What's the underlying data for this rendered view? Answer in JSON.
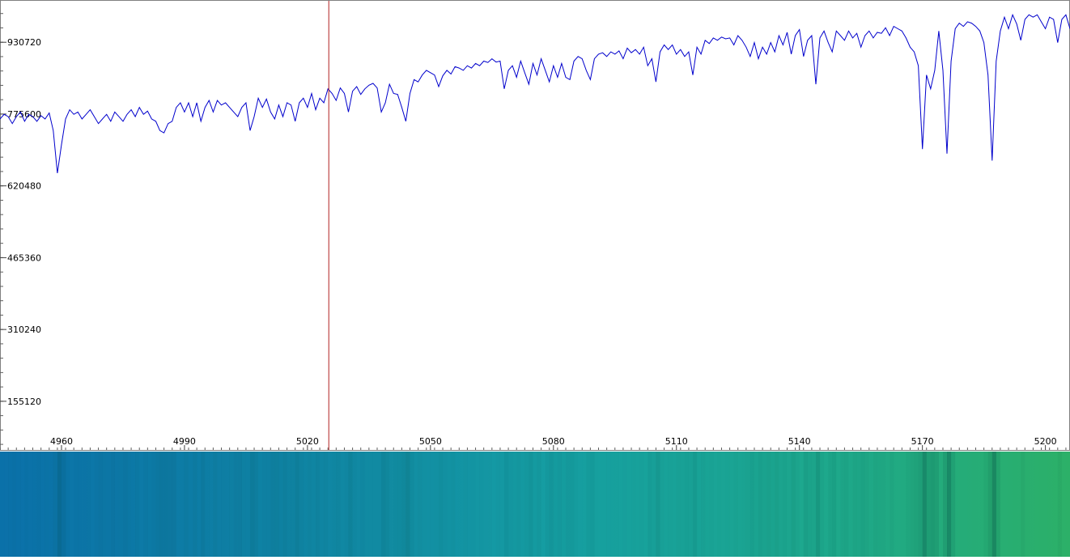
{
  "chart_data": {
    "type": "line",
    "title": "",
    "xlabel": "",
    "ylabel": "",
    "xlim": [
      4945,
      5206
    ],
    "ylim": [
      50000,
      1022000
    ],
    "xticks": [
      4960,
      4990,
      5020,
      5050,
      5080,
      5110,
      5140,
      5170,
      5200
    ],
    "yticks": [
      155120,
      310240,
      465360,
      620480,
      775600,
      930720
    ],
    "cursor_x": 5025.2,
    "line_color": "#0000cc",
    "cursor_color": "#b02020",
    "series": [
      {
        "values": [
          [
            4945,
            765000
          ],
          [
            4946,
            775000
          ],
          [
            4947,
            770000
          ],
          [
            4948,
            755000
          ],
          [
            4949,
            770000
          ],
          [
            4950,
            780000
          ],
          [
            4951,
            760000
          ],
          [
            4952,
            775000
          ],
          [
            4953,
            770000
          ],
          [
            4954,
            760000
          ],
          [
            4955,
            772000
          ],
          [
            4956,
            765000
          ],
          [
            4957,
            778000
          ],
          [
            4958,
            740000
          ],
          [
            4959,
            648000
          ],
          [
            4960,
            710000
          ],
          [
            4961,
            765000
          ],
          [
            4962,
            785000
          ],
          [
            4963,
            775000
          ],
          [
            4964,
            780000
          ],
          [
            4965,
            765000
          ],
          [
            4966,
            775000
          ],
          [
            4967,
            785000
          ],
          [
            4968,
            770000
          ],
          [
            4969,
            755000
          ],
          [
            4970,
            765000
          ],
          [
            4971,
            775000
          ],
          [
            4972,
            760000
          ],
          [
            4973,
            780000
          ],
          [
            4974,
            770000
          ],
          [
            4975,
            760000
          ],
          [
            4976,
            775000
          ],
          [
            4977,
            785000
          ],
          [
            4978,
            770000
          ],
          [
            4979,
            790000
          ],
          [
            4980,
            775000
          ],
          [
            4981,
            782000
          ],
          [
            4982,
            765000
          ],
          [
            4983,
            760000
          ],
          [
            4984,
            740000
          ],
          [
            4985,
            735000
          ],
          [
            4986,
            755000
          ],
          [
            4987,
            760000
          ],
          [
            4988,
            790000
          ],
          [
            4989,
            800000
          ],
          [
            4990,
            780000
          ],
          [
            4991,
            800000
          ],
          [
            4992,
            770000
          ],
          [
            4993,
            800000
          ],
          [
            4994,
            760000
          ],
          [
            4995,
            790000
          ],
          [
            4996,
            805000
          ],
          [
            4997,
            780000
          ],
          [
            4998,
            805000
          ],
          [
            4999,
            795000
          ],
          [
            5000,
            800000
          ],
          [
            5001,
            790000
          ],
          [
            5002,
            780000
          ],
          [
            5003,
            770000
          ],
          [
            5004,
            790000
          ],
          [
            5005,
            800000
          ],
          [
            5006,
            740000
          ],
          [
            5007,
            770000
          ],
          [
            5008,
            810000
          ],
          [
            5009,
            790000
          ],
          [
            5010,
            808000
          ],
          [
            5011,
            780000
          ],
          [
            5012,
            765000
          ],
          [
            5013,
            795000
          ],
          [
            5014,
            770000
          ],
          [
            5015,
            800000
          ],
          [
            5016,
            795000
          ],
          [
            5017,
            760000
          ],
          [
            5018,
            800000
          ],
          [
            5019,
            810000
          ],
          [
            5020,
            790000
          ],
          [
            5021,
            820000
          ],
          [
            5022,
            785000
          ],
          [
            5023,
            810000
          ],
          [
            5024,
            800000
          ],
          [
            5025,
            830000
          ],
          [
            5026,
            820000
          ],
          [
            5027,
            805000
          ],
          [
            5028,
            832000
          ],
          [
            5029,
            820000
          ],
          [
            5030,
            780000
          ],
          [
            5031,
            825000
          ],
          [
            5032,
            835000
          ],
          [
            5033,
            818000
          ],
          [
            5034,
            830000
          ],
          [
            5035,
            838000
          ],
          [
            5036,
            842000
          ],
          [
            5037,
            832000
          ],
          [
            5038,
            780000
          ],
          [
            5039,
            800000
          ],
          [
            5040,
            840000
          ],
          [
            5041,
            820000
          ],
          [
            5042,
            818000
          ],
          [
            5043,
            790000
          ],
          [
            5044,
            760000
          ],
          [
            5045,
            820000
          ],
          [
            5046,
            850000
          ],
          [
            5047,
            845000
          ],
          [
            5048,
            860000
          ],
          [
            5049,
            870000
          ],
          [
            5050,
            865000
          ],
          [
            5051,
            860000
          ],
          [
            5052,
            835000
          ],
          [
            5053,
            858000
          ],
          [
            5054,
            870000
          ],
          [
            5055,
            862000
          ],
          [
            5056,
            878000
          ],
          [
            5057,
            875000
          ],
          [
            5058,
            870000
          ],
          [
            5059,
            880000
          ],
          [
            5060,
            875000
          ],
          [
            5061,
            885000
          ],
          [
            5062,
            880000
          ],
          [
            5063,
            890000
          ],
          [
            5064,
            887000
          ],
          [
            5065,
            895000
          ],
          [
            5066,
            888000
          ],
          [
            5067,
            890000
          ],
          [
            5068,
            830000
          ],
          [
            5069,
            870000
          ],
          [
            5070,
            880000
          ],
          [
            5071,
            855000
          ],
          [
            5072,
            890000
          ],
          [
            5073,
            865000
          ],
          [
            5074,
            840000
          ],
          [
            5075,
            885000
          ],
          [
            5076,
            860000
          ],
          [
            5077,
            895000
          ],
          [
            5078,
            870000
          ],
          [
            5079,
            845000
          ],
          [
            5080,
            880000
          ],
          [
            5081,
            855000
          ],
          [
            5082,
            885000
          ],
          [
            5083,
            855000
          ],
          [
            5084,
            850000
          ],
          [
            5085,
            890000
          ],
          [
            5086,
            900000
          ],
          [
            5087,
            895000
          ],
          [
            5088,
            870000
          ],
          [
            5089,
            850000
          ],
          [
            5090,
            895000
          ],
          [
            5091,
            905000
          ],
          [
            5092,
            908000
          ],
          [
            5093,
            900000
          ],
          [
            5094,
            910000
          ],
          [
            5095,
            905000
          ],
          [
            5096,
            912000
          ],
          [
            5097,
            895000
          ],
          [
            5098,
            918000
          ],
          [
            5099,
            908000
          ],
          [
            5100,
            915000
          ],
          [
            5101,
            905000
          ],
          [
            5102,
            920000
          ],
          [
            5103,
            880000
          ],
          [
            5104,
            895000
          ],
          [
            5105,
            845000
          ],
          [
            5106,
            910000
          ],
          [
            5107,
            925000
          ],
          [
            5108,
            915000
          ],
          [
            5109,
            925000
          ],
          [
            5110,
            905000
          ],
          [
            5111,
            915000
          ],
          [
            5112,
            900000
          ],
          [
            5113,
            910000
          ],
          [
            5114,
            860000
          ],
          [
            5115,
            920000
          ],
          [
            5116,
            905000
          ],
          [
            5117,
            935000
          ],
          [
            5118,
            928000
          ],
          [
            5119,
            940000
          ],
          [
            5120,
            935000
          ],
          [
            5121,
            942000
          ],
          [
            5122,
            938000
          ],
          [
            5123,
            940000
          ],
          [
            5124,
            925000
          ],
          [
            5125,
            945000
          ],
          [
            5126,
            935000
          ],
          [
            5127,
            920000
          ],
          [
            5128,
            900000
          ],
          [
            5129,
            930000
          ],
          [
            5130,
            895000
          ],
          [
            5131,
            920000
          ],
          [
            5132,
            905000
          ],
          [
            5133,
            930000
          ],
          [
            5134,
            910000
          ],
          [
            5135,
            945000
          ],
          [
            5136,
            925000
          ],
          [
            5137,
            952000
          ],
          [
            5138,
            905000
          ],
          [
            5139,
            945000
          ],
          [
            5140,
            958000
          ],
          [
            5141,
            900000
          ],
          [
            5142,
            935000
          ],
          [
            5143,
            945000
          ],
          [
            5144,
            840000
          ],
          [
            5145,
            940000
          ],
          [
            5146,
            955000
          ],
          [
            5147,
            930000
          ],
          [
            5148,
            910000
          ],
          [
            5149,
            955000
          ],
          [
            5150,
            945000
          ],
          [
            5151,
            935000
          ],
          [
            5152,
            955000
          ],
          [
            5153,
            940000
          ],
          [
            5154,
            950000
          ],
          [
            5155,
            920000
          ],
          [
            5156,
            945000
          ],
          [
            5157,
            955000
          ],
          [
            5158,
            940000
          ],
          [
            5159,
            952000
          ],
          [
            5160,
            950000
          ],
          [
            5161,
            962000
          ],
          [
            5162,
            945000
          ],
          [
            5163,
            965000
          ],
          [
            5164,
            960000
          ],
          [
            5165,
            955000
          ],
          [
            5166,
            940000
          ],
          [
            5167,
            920000
          ],
          [
            5168,
            910000
          ],
          [
            5169,
            880000
          ],
          [
            5170,
            700000
          ],
          [
            5171,
            860000
          ],
          [
            5172,
            830000
          ],
          [
            5173,
            870000
          ],
          [
            5174,
            955000
          ],
          [
            5175,
            870000
          ],
          [
            5176,
            690000
          ],
          [
            5177,
            890000
          ],
          [
            5178,
            960000
          ],
          [
            5179,
            972000
          ],
          [
            5180,
            965000
          ],
          [
            5181,
            975000
          ],
          [
            5182,
            972000
          ],
          [
            5183,
            965000
          ],
          [
            5184,
            955000
          ],
          [
            5185,
            930000
          ],
          [
            5186,
            860000
          ],
          [
            5187,
            675000
          ],
          [
            5188,
            890000
          ],
          [
            5189,
            955000
          ],
          [
            5190,
            985000
          ],
          [
            5191,
            960000
          ],
          [
            5192,
            990000
          ],
          [
            5193,
            970000
          ],
          [
            5194,
            935000
          ],
          [
            5195,
            980000
          ],
          [
            5196,
            990000
          ],
          [
            5197,
            985000
          ],
          [
            5198,
            990000
          ],
          [
            5199,
            975000
          ],
          [
            5200,
            960000
          ],
          [
            5201,
            985000
          ],
          [
            5202,
            980000
          ],
          [
            5203,
            930000
          ],
          [
            5204,
            980000
          ],
          [
            5205,
            990000
          ],
          [
            5206,
            960000
          ]
        ]
      }
    ]
  },
  "spectrum_strip": {
    "gradient_stops": [
      {
        "pos": 0.0,
        "color": "#0e80c8"
      },
      {
        "pos": 0.35,
        "color": "#1498b4"
      },
      {
        "pos": 0.55,
        "color": "#18a8a8"
      },
      {
        "pos": 0.8,
        "color": "#1ea888"
      },
      {
        "pos": 1.0,
        "color": "#2cb068"
      }
    ]
  }
}
